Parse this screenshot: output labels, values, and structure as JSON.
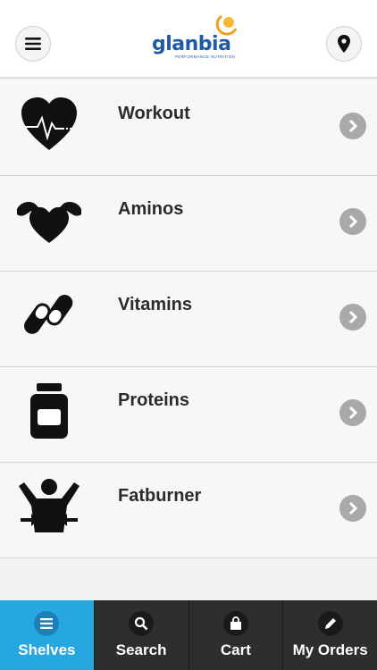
{
  "header": {
    "logo_text": "glanbia",
    "logo_sub": "PERFORMANCE NUTRITION",
    "menu_icon": "hamburger-menu-icon",
    "location_icon": "map-pin-icon"
  },
  "shelves": [
    {
      "label": "Workout",
      "icon": "heartbeat-icon"
    },
    {
      "label": "Aminos",
      "icon": "muscle-heart-icon"
    },
    {
      "label": "Vitamins",
      "icon": "pills-icon"
    },
    {
      "label": "Proteins",
      "icon": "protein-jar-icon"
    },
    {
      "label": "Fatburner",
      "icon": "fatburner-person-icon"
    }
  ],
  "tabs": [
    {
      "label": "Shelves",
      "icon": "list-icon",
      "active": true
    },
    {
      "label": "Search",
      "icon": "search-icon",
      "active": false
    },
    {
      "label": "Cart",
      "icon": "shopping-bag-icon",
      "active": false
    },
    {
      "label": "My Orders",
      "icon": "pencil-icon",
      "active": false
    }
  ],
  "colors": {
    "brand_blue": "#1f5aa6",
    "brand_orange": "#f0a020",
    "active_tab": "#27a7e0",
    "tabbar_bg": "#2e2e2e",
    "chevron_bg": "#a9a9a9"
  }
}
